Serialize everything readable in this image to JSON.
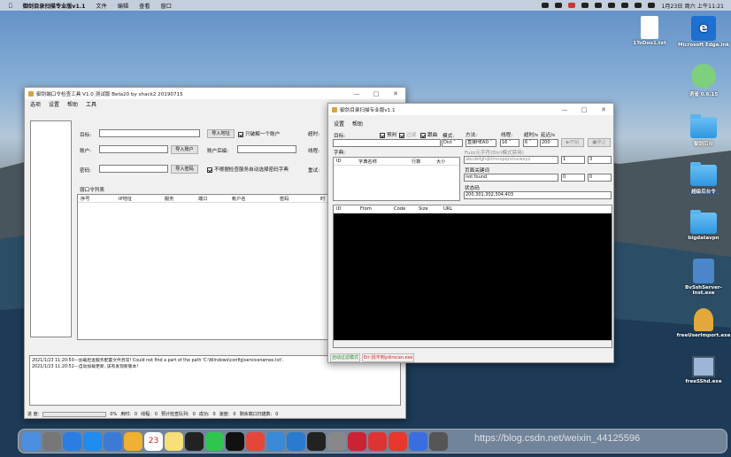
{
  "menubar": {
    "app": "御剑目录扫描专业版v1.1",
    "items": [
      "文件",
      "编辑",
      "查看",
      "窗口"
    ],
    "datetime": "1月23日 周六 上午11:21"
  },
  "win1": {
    "title": "御剑端口令检查工具 V1.0 测试版 Beta20 by shack2 20190715",
    "menu": [
      "选项",
      "设置",
      "帮助",
      "工具"
    ],
    "target_label": "目标:",
    "import_addr": "导入地址",
    "only_one_label": "只破解一个账户",
    "timeout_label": "超时:",
    "account_label": "账户:",
    "import_account": "导入账户",
    "account_suffix_label": "账户后缀:",
    "thread_label": "线程:",
    "password_label": "密码:",
    "import_password": "导入密码",
    "not_check_label": "不根据检查服务自动选择密码字典",
    "retry_label": "重试:",
    "list_label": "弱口令列表",
    "columns": [
      "序号",
      "IP地址",
      "服务",
      "端口",
      "帐户名",
      "密码",
      "时"
    ],
    "logs": [
      "2021/1/23 11:20:50---加载检查服务配置文件异常! Could not find a part of the path 'C:\\Windows\\config\\servicenames.txt'.",
      "2021/1/23 11:20:52---自动加载更新, 该有发现新版本!"
    ],
    "status": "进 度:",
    "status_items": [
      "0%",
      "用时:",
      "0",
      "线程:",
      "0",
      "预计检查队列:",
      "0",
      "成功:",
      "0",
      "速度:",
      "0",
      "剩余端口扫描数:",
      "0"
    ]
  },
  "win2": {
    "title": "御剑目录扫描专业版v1.1",
    "menu": [
      "设置",
      "帮助"
    ],
    "target_label": "目标:",
    "predict_label": "预判",
    "filter_label": "过滤",
    "follow_label": "跟曲",
    "mode_label": "模式:",
    "mode_value": "Dict",
    "method_label": "方法:",
    "method_value": "直接HEAD",
    "thread_label": "线程:",
    "thread_value": "16",
    "timeout_label": "超时/s",
    "timeout_value": "6",
    "delay_label": "延迟/s",
    "delay_value": "200",
    "start": "开始",
    "stop": "停止",
    "dict_label": "字典:",
    "dict_cols": [
      "ID",
      "字典名称",
      "行数",
      "大小"
    ],
    "fuzz_label": "Fuzz元字符(Dict模式禁用)",
    "fuzz_value": "abcdefghijklmnopqrstuvwxyz",
    "fuzz_min": "1",
    "fuzz_max": "3",
    "page_keyword_label": "页面关键词",
    "page_keyword_value": "not found",
    "pk_a": "0",
    "pk_b": "0",
    "status_code_label": "状态码",
    "status_code_value": "200,301,302,304,403",
    "result_cols": [
      "ID",
      "From",
      "Code",
      "Size",
      "URL"
    ],
    "status_auto": "自动过滤模式",
    "status_err": "Err:找不到ydirscan.exe"
  },
  "desktop": [
    {
      "label": "1ToDoo1.txt"
    },
    {
      "label": "Microsoft Edge.lnk"
    },
    {
      "label": "语雀 0.6.15"
    },
    {
      "label": "御剑后台"
    },
    {
      "label": "超级后台令"
    },
    {
      "label": "bigdatavpn"
    },
    {
      "label": "BvSshServer-Inst.exe"
    },
    {
      "label": "freeUserImport.exe"
    },
    {
      "label": "freeSShd.exe"
    }
  ],
  "watermark": "https://blog.csdn.net/weixin_44125596"
}
